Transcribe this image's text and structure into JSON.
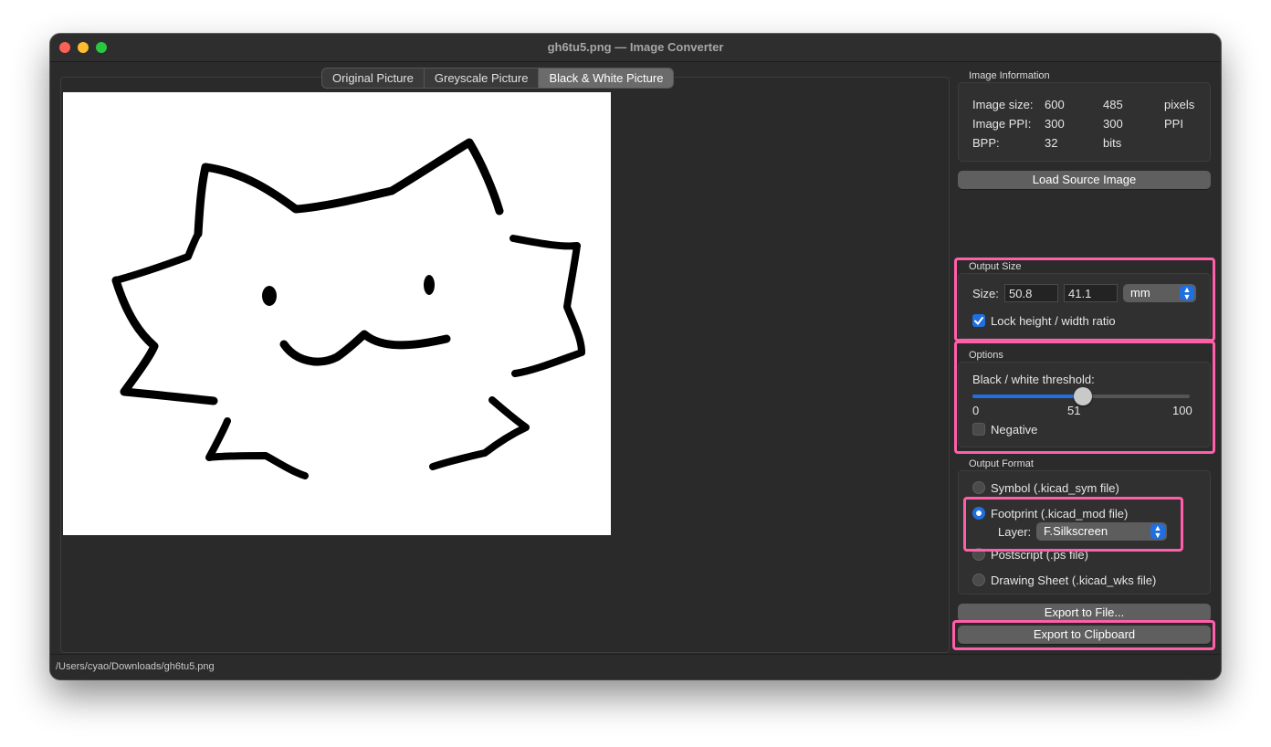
{
  "window": {
    "title": "gh6tu5.png — Image Converter",
    "status_path": "/Users/cyao/Downloads/gh6tu5.png"
  },
  "tabs": [
    {
      "label": "Original Picture",
      "active": false
    },
    {
      "label": "Greyscale Picture",
      "active": false
    },
    {
      "label": "Black & White Picture",
      "active": true
    }
  ],
  "image_info": {
    "section_label": "Image Information",
    "rows": [
      {
        "label": "Image size:",
        "v1": "600",
        "v2": "485",
        "unit": "pixels"
      },
      {
        "label": "Image PPI:",
        "v1": "300",
        "v2": "300",
        "unit": "PPI"
      },
      {
        "label": "BPP:",
        "v1": "32",
        "v2": "bits",
        "unit": ""
      }
    ]
  },
  "load_button": "Load Source Image",
  "output_size": {
    "section_label": "Output Size",
    "size_label": "Size:",
    "width": "50.8",
    "height": "41.1",
    "unit": "mm",
    "lock_label": "Lock height / width ratio",
    "lock_checked": true
  },
  "options": {
    "section_label": "Options",
    "threshold_label": "Black / white threshold:",
    "slider_min": "0",
    "slider_value": "51",
    "slider_max": "100",
    "negative_label": "Negative",
    "negative_checked": false
  },
  "output_format": {
    "section_label": "Output Format",
    "items": [
      {
        "label": "Symbol (.kicad_sym file)",
        "selected": false
      },
      {
        "label": "Footprint (.kicad_mod file)",
        "selected": true
      },
      {
        "label": "Postscript (.ps file)",
        "selected": false
      },
      {
        "label": "Drawing Sheet (.kicad_wks file)",
        "selected": false
      }
    ],
    "layer_label": "Layer:",
    "layer_value": "F.Silkscreen"
  },
  "export_file_button": "Export to File...",
  "export_clipboard_button": "Export to Clipboard",
  "colors": {
    "accent": "#1f6fe0",
    "highlight": "#ff5fa8",
    "window_bg": "#2b2b2b"
  }
}
